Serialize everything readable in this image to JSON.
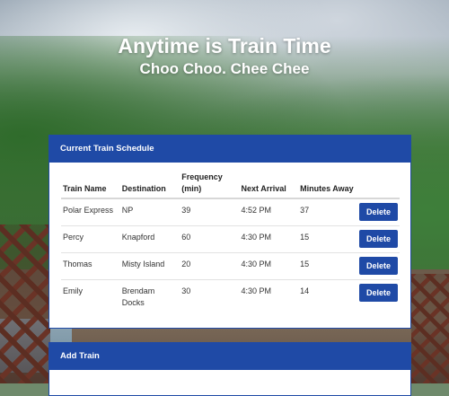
{
  "hero": {
    "title": "Anytime is Train Time",
    "subtitle": "Choo Choo. Chee Chee"
  },
  "schedule": {
    "header": "Current Train Schedule",
    "columns": [
      "Train Name",
      "Destination",
      "Frequency (min)",
      "Next Arrival",
      "Minutes Away"
    ],
    "rows": [
      {
        "name": "Polar Express",
        "destination": "NP",
        "frequency": "39",
        "next_arrival": "4:52 PM",
        "minutes_away": "37",
        "action": "Delete"
      },
      {
        "name": "Percy",
        "destination": "Knapford",
        "frequency": "60",
        "next_arrival": "4:30 PM",
        "minutes_away": "15",
        "action": "Delete"
      },
      {
        "name": "Thomas",
        "destination": "Misty Island",
        "frequency": "20",
        "next_arrival": "4:30 PM",
        "minutes_away": "15",
        "action": "Delete"
      },
      {
        "name": "Emily",
        "destination": "Brendam Docks",
        "frequency": "30",
        "next_arrival": "4:30 PM",
        "minutes_away": "14",
        "action": "Delete"
      }
    ]
  },
  "add_train": {
    "header": "Add Train"
  },
  "colors": {
    "accent": "#1f4aa6",
    "card_bg": "#ffffff"
  }
}
